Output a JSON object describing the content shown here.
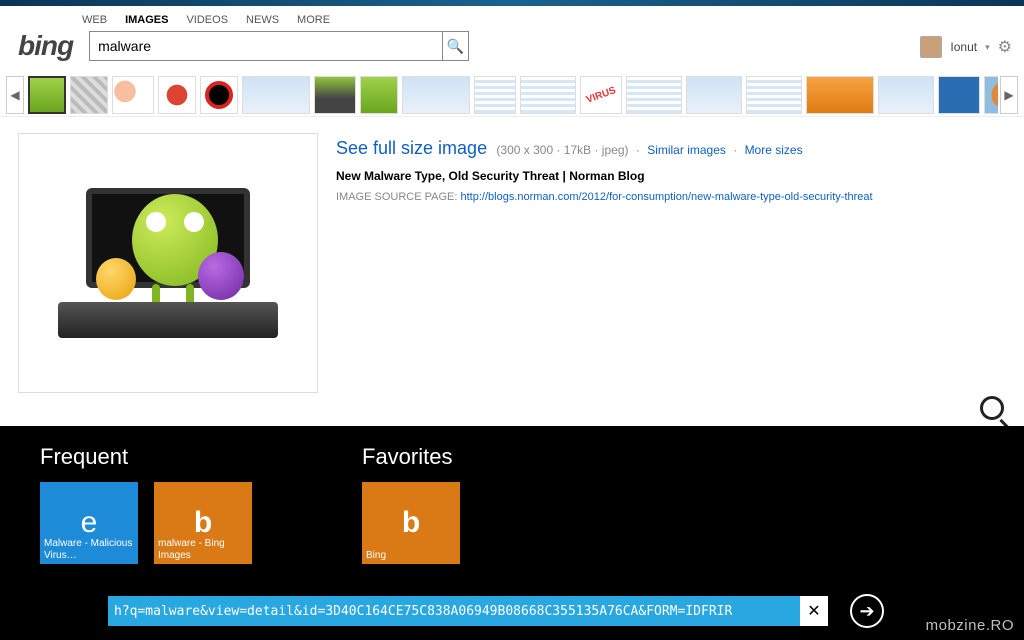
{
  "nav": {
    "web": "WEB",
    "images": "IMAGES",
    "videos": "VIDEOS",
    "news": "NEWS",
    "more": "MORE"
  },
  "logo": "bing",
  "search": {
    "value": "malware"
  },
  "user": {
    "name": "Ionut"
  },
  "detail": {
    "full_link": "See full size image",
    "dims": "(300 x 300 · 17kB · jpeg)",
    "similar": "Similar images",
    "more_sizes": "More sizes",
    "title": "New Malware Type, Old Security Threat | Norman Blog",
    "source_label": "IMAGE SOURCE PAGE:",
    "source_url": "http://blogs.norman.com/2012/for-consumption/new-malware-type-old-security-threat"
  },
  "metro": {
    "frequent_title": "Frequent",
    "favorites_title": "Favorites",
    "tiles": {
      "ie": "Malware - Malicious Virus…",
      "bing_img": "malware - Bing Images",
      "bing_fav": "Bing"
    }
  },
  "address_bar": {
    "value": "h?q=malware&view=detail&id=3D40C164CE75C838A06949B08668C355135A76CA&FORM=IDFRIR"
  },
  "watermark": "mobzine.RO"
}
